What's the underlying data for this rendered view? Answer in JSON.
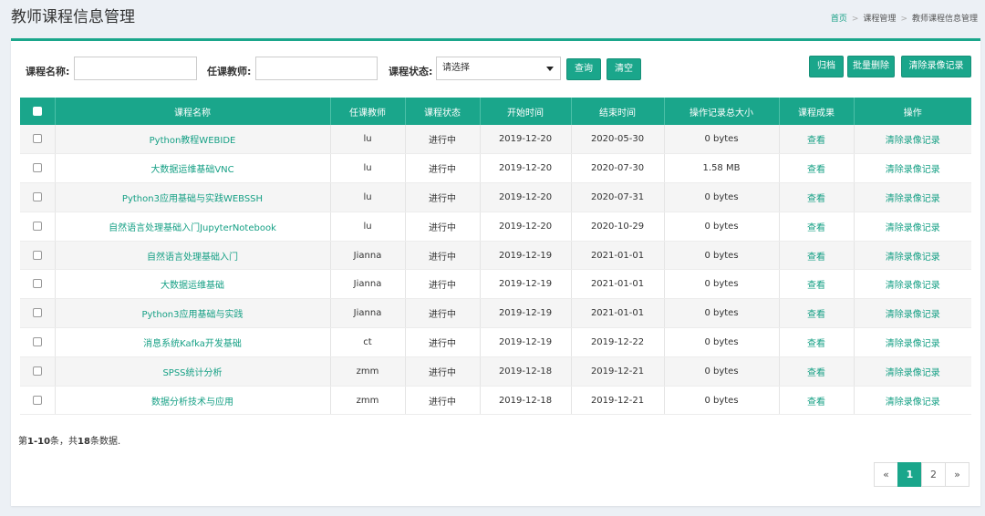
{
  "header": {
    "title": "教师课程信息管理",
    "breadcrumb": [
      "首页",
      "课程管理",
      "教师课程信息管理"
    ]
  },
  "filters": {
    "course_name_label": "课程名称:",
    "course_name_value": "",
    "teacher_label": "任课教师:",
    "teacher_value": "",
    "status_label": "课程状态:",
    "status_selected": "请选择",
    "query_button": "查询",
    "clear_button": "清空"
  },
  "actions": {
    "archive_button": "归档",
    "batch_delete_button": "批量删除",
    "clear_video_button": "清除录像记录"
  },
  "table": {
    "headers": [
      "课程名称",
      "任课教师",
      "课程状态",
      "开始时间",
      "结束时间",
      "操作记录总大小",
      "课程成果",
      "操作"
    ],
    "rows": [
      {
        "name": "Python教程WEBIDE",
        "teacher": "lu",
        "status": "进行中",
        "start": "2019-12-20",
        "end": "2020-05-30",
        "size": "0 bytes",
        "result": "查看",
        "op": "清除录像记录"
      },
      {
        "name": "大数据运维基础VNC",
        "teacher": "lu",
        "status": "进行中",
        "start": "2019-12-20",
        "end": "2020-07-30",
        "size": "1.58 MB",
        "result": "查看",
        "op": "清除录像记录"
      },
      {
        "name": "Python3应用基础与实践WEBSSH",
        "teacher": "lu",
        "status": "进行中",
        "start": "2019-12-20",
        "end": "2020-07-31",
        "size": "0 bytes",
        "result": "查看",
        "op": "清除录像记录"
      },
      {
        "name": "自然语言处理基础入门JupyterNotebook",
        "teacher": "lu",
        "status": "进行中",
        "start": "2019-12-20",
        "end": "2020-10-29",
        "size": "0 bytes",
        "result": "查看",
        "op": "清除录像记录"
      },
      {
        "name": "自然语言处理基础入门",
        "teacher": "Jianna",
        "status": "进行中",
        "start": "2019-12-19",
        "end": "2021-01-01",
        "size": "0 bytes",
        "result": "查看",
        "op": "清除录像记录"
      },
      {
        "name": "大数据运维基础",
        "teacher": "Jianna",
        "status": "进行中",
        "start": "2019-12-19",
        "end": "2021-01-01",
        "size": "0 bytes",
        "result": "查看",
        "op": "清除录像记录"
      },
      {
        "name": "Python3应用基础与实践",
        "teacher": "Jianna",
        "status": "进行中",
        "start": "2019-12-19",
        "end": "2021-01-01",
        "size": "0 bytes",
        "result": "查看",
        "op": "清除录像记录"
      },
      {
        "name": "消息系统Kafka开发基础",
        "teacher": "ct",
        "status": "进行中",
        "start": "2019-12-19",
        "end": "2019-12-22",
        "size": "0 bytes",
        "result": "查看",
        "op": "清除录像记录"
      },
      {
        "name": "SPSS统计分析",
        "teacher": "zmm",
        "status": "进行中",
        "start": "2019-12-18",
        "end": "2019-12-21",
        "size": "0 bytes",
        "result": "查看",
        "op": "清除录像记录"
      },
      {
        "name": "数据分析技术与应用",
        "teacher": "zmm",
        "status": "进行中",
        "start": "2019-12-18",
        "end": "2019-12-21",
        "size": "0 bytes",
        "result": "查看",
        "op": "清除录像记录"
      }
    ]
  },
  "summary": {
    "prefix": "第",
    "range": "1-10",
    "middle": "条，共",
    "total": "18",
    "suffix": "条数据."
  },
  "pagination": {
    "prev": "«",
    "pages": [
      "1",
      "2"
    ],
    "next": "»"
  },
  "colors": {
    "accent": "#1aa68b",
    "link": "#16a085"
  }
}
